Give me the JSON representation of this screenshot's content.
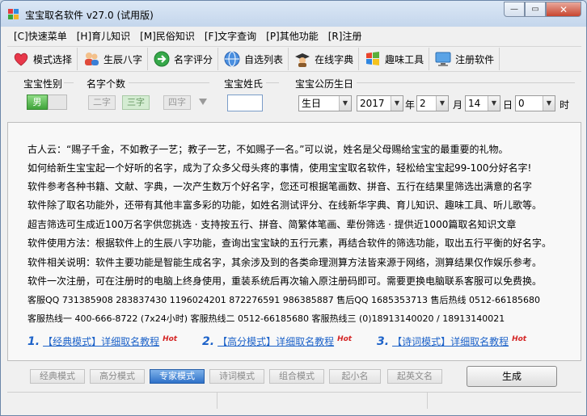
{
  "window": {
    "title": "宝宝取名软件 v27.0 (试用版)"
  },
  "menu": [
    "[C]快速菜单",
    "[H]育儿知识",
    "[M]民俗知识",
    "[F]文字查询",
    "[P]其他功能",
    "[R]注册"
  ],
  "toolbar": [
    {
      "label": "模式选择",
      "icon": "heart-icon"
    },
    {
      "label": "生辰八字",
      "icon": "people-icon"
    },
    {
      "label": "名字评分",
      "icon": "arrow-circle-icon"
    },
    {
      "label": "自选列表",
      "icon": "globe-icon"
    },
    {
      "label": "在线字典",
      "icon": "scholar-icon"
    },
    {
      "label": "趣味工具",
      "icon": "windows-flag-icon"
    },
    {
      "label": "注册软件",
      "icon": "monitor-icon"
    }
  ],
  "options": {
    "gender_label": "宝宝性别",
    "gender_value": "男",
    "count_label": "名字个数",
    "count_options": [
      "二字",
      "三字",
      "四字"
    ],
    "count_selected": "三字",
    "surname_label": "宝宝姓氏",
    "surname_value": "",
    "birth_label": "宝宝公历生日",
    "birth_type": "生日",
    "year": "2017",
    "year_unit": "年",
    "month": "2",
    "month_unit": "月",
    "day": "14",
    "day_unit": "日",
    "hour": "0",
    "hour_unit": "时"
  },
  "content": {
    "lines": [
      "古人云：“赐子千金，不如教子一艺；教子一艺，不如赐子一名。”可以说，姓名是父母赐给宝宝的最重要的礼物。",
      "如何给新生宝宝起一个好听的名字，成为了众多父母头疼的事情，使用宝宝取名软件，轻松给宝宝起99-100分好名字!",
      "软件参考各种书籍、文献、字典，一次产生数万个好名字，您还可根据笔画数、拼音、五行在结果里筛选出满意的名字",
      "软件除了取名功能外，还带有其他丰富多彩的功能，如姓名测试评分、在线新华字典、育儿知识、趣味工具、听儿歌等。",
      "超吉筛选可生成近100万名字供您挑选   · 支持按五行、拼音、简繁体笔画、辈份筛选  · 提供近1000篇取名知识文章",
      "软件使用方法：根据软件上的生辰八字功能，查询出宝宝缺的五行元素，再结合软件的筛选功能，取出五行平衡的好名字。",
      "软件相关说明：软件主要功能是智能生成名字，其余涉及到的各类命理测算方法皆来源于网络，测算结果仅作娱乐参考。",
      "软件一次注册，可在注册时的电脑上终身使用，重装系统后再次输入原注册码即可。需要更换电脑联系客服可以免费换。",
      "客服QQ  731385908   283837430   1196024201   872276591   986385887    售后QQ  1685353713    售后热线  0512-66185680",
      "客服热线一  400-666-8722  (7x24小时)    客服热线二  0512-66185680      客服热线三  (0)18913140020 / 18913140021"
    ],
    "modes": [
      {
        "num": "1.",
        "link": "【经典模式】详细取名教程",
        "hot": "Hot"
      },
      {
        "num": "2.",
        "link": "【高分模式】详细取名教程",
        "hot": "Hot"
      },
      {
        "num": "3.",
        "link": "【诗词模式】详细取名教程",
        "hot": "Hot"
      }
    ]
  },
  "bottom": {
    "tabs": [
      "经典模式",
      "高分模式",
      "专家模式",
      "诗词模式",
      "组合模式",
      "起小名",
      "起英文名"
    ],
    "active_tab": "专家模式",
    "generate_label": "生成"
  },
  "colors": {
    "accent": "#2f71c8",
    "link": "#1e63c9",
    "hot": "#d42424",
    "gender_on": "#3fa33a"
  }
}
